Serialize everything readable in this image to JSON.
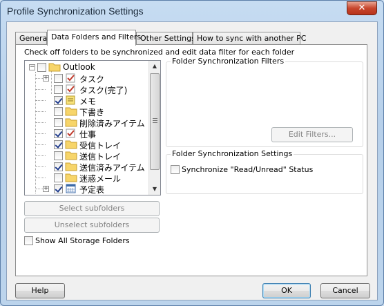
{
  "window": {
    "title": "Profile Synchronization Settings",
    "close_glyph": "✕"
  },
  "tabs": [
    {
      "label": "General"
    },
    {
      "label": "Data Folders and Filters",
      "active": true
    },
    {
      "label": "Other Settings"
    },
    {
      "label": "How to sync with another PC"
    }
  ],
  "instruction": "Check off folders to be synchronized and edit data filter for each folder",
  "tree": {
    "items": [
      {
        "label": "Outlook",
        "checked": false,
        "expander": "−",
        "icon": "outlook-folder-icon"
      },
      {
        "label": "タスク",
        "checked": false,
        "expander": "+",
        "icon": "task-icon"
      },
      {
        "label": "タスク(完了)",
        "checked": false,
        "icon": "task-icon"
      },
      {
        "label": "メモ",
        "checked": true,
        "icon": "note-icon"
      },
      {
        "label": "下書き",
        "checked": false,
        "icon": "folder-icon"
      },
      {
        "label": "削除済みアイテム",
        "checked": false,
        "icon": "folder-icon"
      },
      {
        "label": "仕事",
        "checked": true,
        "icon": "task-icon"
      },
      {
        "label": "受信トレイ",
        "checked": true,
        "icon": "folder-icon"
      },
      {
        "label": "送信トレイ",
        "checked": false,
        "icon": "folder-icon"
      },
      {
        "label": "送信済みアイテム",
        "checked": true,
        "icon": "folder-icon"
      },
      {
        "label": "迷惑メール",
        "checked": false,
        "icon": "folder-icon"
      },
      {
        "label": "予定表",
        "checked": true,
        "expander": "+",
        "icon": "calendar-icon"
      }
    ]
  },
  "buttons": {
    "select_subfolders": "Select subfolders",
    "unselect_subfolders": "Unselect subfolders",
    "edit_filters": "Edit Filters...",
    "help": "Help",
    "ok": "OK",
    "cancel": "Cancel"
  },
  "show_all_storage": {
    "label": "Show All Storage Folders",
    "checked": false
  },
  "filters_group": {
    "title": "Folder Synchronization Filters"
  },
  "settings_group": {
    "title": "Folder Synchronization Settings",
    "sync_read_unread": {
      "label": "Synchronize \"Read/Unread\" Status",
      "checked": false
    }
  }
}
